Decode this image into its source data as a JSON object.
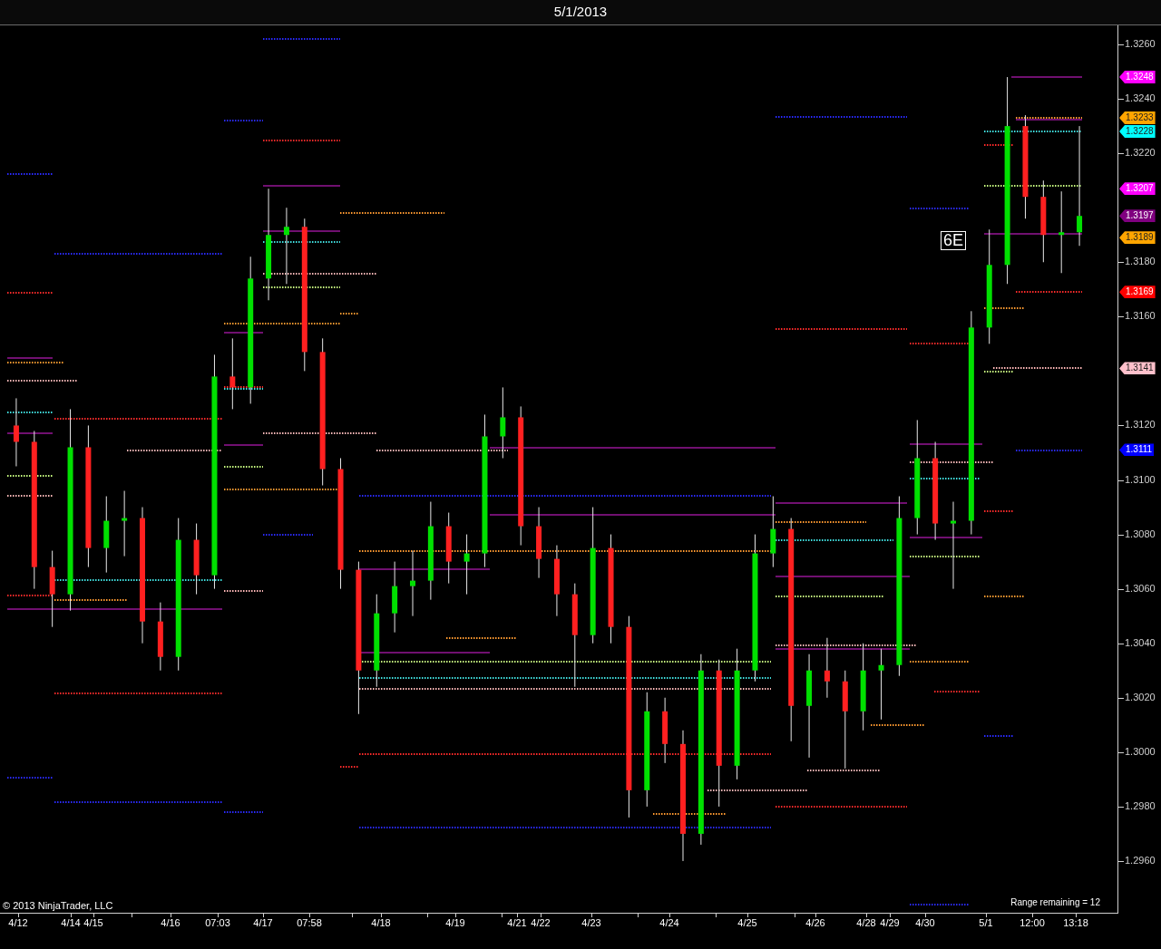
{
  "title": "5/1/2013",
  "price_markers": [
    {
      "label": "1.3248",
      "color": "#ff00ff"
    },
    {
      "label": "1.3233",
      "color": "#ffa500"
    },
    {
      "label": "1.3228",
      "color": "#00ffff"
    },
    {
      "label": "1.3207",
      "color": "#ff00ff"
    },
    {
      "label": "1.3197",
      "color": "#800080"
    },
    {
      "label": "1.3189",
      "color": "#ffa500"
    },
    {
      "label": "1.3169",
      "color": "#ff0000"
    },
    {
      "label": "1.3141",
      "color": "#ffc0cb"
    },
    {
      "label": "1.3111",
      "color": "#0000ff"
    }
  ],
  "chart_data": {
    "type": "candlestick",
    "ylim": [
      1.2941,
      1.3267
    ],
    "yticks": [
      {
        "value": 1.326,
        "label": "1.3260"
      },
      {
        "value": 1.324,
        "label": "1.3240"
      },
      {
        "value": 1.322,
        "label": "1.3220"
      },
      {
        "value": 1.318,
        "label": "1.3180"
      },
      {
        "value": 1.316,
        "label": "1.3160"
      },
      {
        "value": 1.312,
        "label": "1.3120"
      },
      {
        "value": 1.31,
        "label": "1.3100"
      },
      {
        "value": 1.308,
        "label": "1.3080"
      },
      {
        "value": 1.306,
        "label": "1.3060"
      },
      {
        "value": 1.304,
        "label": "1.3040"
      },
      {
        "value": 1.302,
        "label": "1.3020"
      },
      {
        "value": 1.3,
        "label": "1.3000"
      },
      {
        "value": 1.298,
        "label": "1.2980"
      },
      {
        "value": 1.296,
        "label": "1.2960"
      }
    ],
    "categories": [
      null,
      null,
      null,
      null,
      null,
      null,
      null,
      null,
      null,
      null,
      null,
      null,
      null,
      null,
      null,
      null,
      null,
      null,
      null,
      null,
      null,
      null,
      null,
      null,
      null,
      null,
      null,
      null,
      null,
      null,
      null,
      null,
      null,
      null,
      null,
      null,
      null,
      null,
      null,
      null,
      null,
      null,
      null,
      null,
      null,
      null,
      null,
      null,
      null,
      null,
      null,
      null,
      null,
      null,
      null,
      null,
      null,
      null,
      null,
      null
    ],
    "ohlc": [
      [
        1.312,
        1.313,
        1.3105,
        1.3114
      ],
      [
        1.3114,
        1.3118,
        1.306,
        1.3068
      ],
      [
        1.3068,
        1.3074,
        1.3046,
        1.3058
      ],
      [
        1.3058,
        1.3126,
        1.3052,
        1.3112
      ],
      [
        1.3112,
        1.312,
        1.3068,
        1.3075
      ],
      [
        1.3075,
        1.3094,
        1.3066,
        1.3085
      ],
      [
        1.3085,
        1.3096,
        1.3072,
        1.3086
      ],
      [
        1.3086,
        1.309,
        1.304,
        1.3048
      ],
      [
        1.3048,
        1.3055,
        1.303,
        1.3035
      ],
      [
        1.3035,
        1.3086,
        1.303,
        1.3078
      ],
      [
        1.3078,
        1.3084,
        1.3058,
        1.3065
      ],
      [
        1.3065,
        1.3146,
        1.306,
        1.3138
      ],
      [
        1.3138,
        1.3152,
        1.3126,
        1.3134
      ],
      [
        1.3134,
        1.3182,
        1.3128,
        1.3174
      ],
      [
        1.3174,
        1.3207,
        1.3166,
        1.319
      ],
      [
        1.319,
        1.32,
        1.3172,
        1.3193
      ],
      [
        1.3193,
        1.3196,
        1.314,
        1.3147
      ],
      [
        1.3147,
        1.3152,
        1.3098,
        1.3104
      ],
      [
        1.3104,
        1.3108,
        1.306,
        1.3067
      ],
      [
        1.3067,
        1.307,
        1.3014,
        1.303
      ],
      [
        1.303,
        1.3058,
        1.3024,
        1.3051
      ],
      [
        1.3051,
        1.307,
        1.3044,
        1.3061
      ],
      [
        1.3061,
        1.3074,
        1.305,
        1.3063
      ],
      [
        1.3063,
        1.3092,
        1.3056,
        1.3083
      ],
      [
        1.3083,
        1.3088,
        1.3062,
        1.307
      ],
      [
        1.307,
        1.308,
        1.3058,
        1.3073
      ],
      [
        1.3073,
        1.3124,
        1.3068,
        1.3116
      ],
      [
        1.3116,
        1.3134,
        1.3108,
        1.3123
      ],
      [
        1.3123,
        1.3127,
        1.3076,
        1.3083
      ],
      [
        1.3083,
        1.309,
        1.3064,
        1.3071
      ],
      [
        1.3071,
        1.3076,
        1.305,
        1.3058
      ],
      [
        1.3058,
        1.3062,
        1.3024,
        1.3043
      ],
      [
        1.3043,
        1.309,
        1.304,
        1.3075
      ],
      [
        1.3075,
        1.308,
        1.304,
        1.3046
      ],
      [
        1.3046,
        1.305,
        1.2976,
        1.2986
      ],
      [
        1.2986,
        1.3022,
        1.298,
        1.3015
      ],
      [
        1.3015,
        1.302,
        1.2996,
        1.3003
      ],
      [
        1.3003,
        1.3008,
        1.296,
        1.297
      ],
      [
        1.297,
        1.3036,
        1.2966,
        1.303
      ],
      [
        1.303,
        1.3034,
        1.298,
        1.2995
      ],
      [
        1.2995,
        1.3038,
        1.299,
        1.303
      ],
      [
        1.303,
        1.308,
        1.3026,
        1.3073
      ],
      [
        1.3073,
        1.3094,
        1.3068,
        1.3082
      ],
      [
        1.3082,
        1.3086,
        1.3004,
        1.3017
      ],
      [
        1.3017,
        1.3036,
        1.2998,
        1.303
      ],
      [
        1.303,
        1.3042,
        1.302,
        1.3026
      ],
      [
        1.3026,
        1.303,
        1.2994,
        1.3015
      ],
      [
        1.3015,
        1.304,
        1.3008,
        1.303
      ],
      [
        1.303,
        1.3038,
        1.3012,
        1.3032
      ],
      [
        1.3032,
        1.3094,
        1.3028,
        1.3086
      ],
      [
        1.3086,
        1.3122,
        1.308,
        1.3108
      ],
      [
        1.3108,
        1.3114,
        1.3078,
        1.3084
      ],
      [
        1.3084,
        1.3092,
        1.306,
        1.3085
      ],
      [
        1.3085,
        1.3162,
        1.308,
        1.3156
      ],
      [
        1.3156,
        1.3192,
        1.315,
        1.3179
      ],
      [
        1.3179,
        1.3248,
        1.3172,
        1.323
      ],
      [
        1.323,
        1.3234,
        1.3196,
        1.3204
      ],
      [
        1.3204,
        1.321,
        1.318,
        1.319
      ],
      [
        1.319,
        1.3206,
        1.3176,
        1.3191
      ],
      [
        1.3191,
        1.323,
        1.3186,
        1.3197
      ]
    ]
  },
  "symbol_label": "6E",
  "time_axis": {
    "labels": [
      "4/12",
      "4/14",
      "4/15",
      "4/16",
      "07:03",
      "4/17",
      "07:58",
      "4/18",
      "4/19",
      "4/21",
      "4/22",
      "4/23",
      "4/24",
      "4/25",
      "4/26",
      "4/28",
      "4/29",
      "4/30",
      "5/1",
      "12:00",
      "13:18"
    ]
  },
  "copyright": "© 2013 NinjaTrader, LLC",
  "range_remaining": "Range remaining = 12"
}
